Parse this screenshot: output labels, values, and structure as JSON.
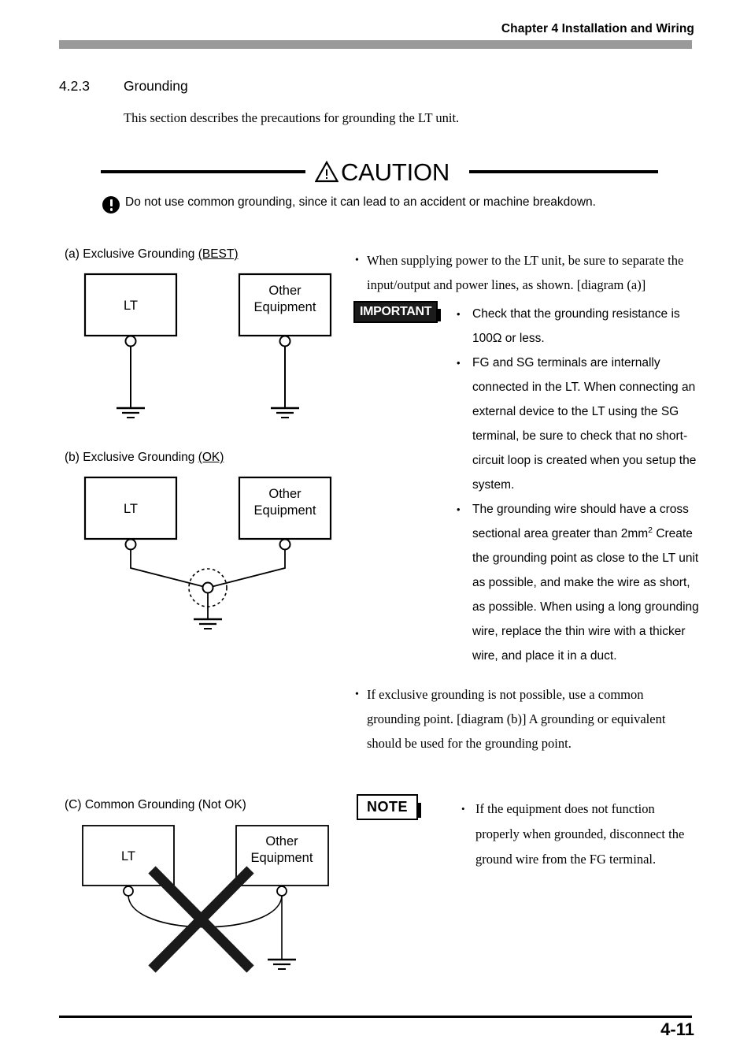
{
  "header": {
    "chapter": "Chapter 4 Installation and Wiring"
  },
  "section": {
    "number": "4.2.3",
    "title": "Grounding",
    "intro": "This section describes the precautions for grounding the LT unit."
  },
  "caution": {
    "label": "CAUTION",
    "icon": "warning-triangle-icon",
    "body_icon": "exclamation-circle-icon",
    "body": "Do not use common grounding, since it can lead to an accident or machine breakdown."
  },
  "diagrams": [
    {
      "id": "a",
      "caption_plain": "(a) Exclusive Grounding ",
      "caption_underlined": "(BEST)",
      "box_left": "LT",
      "box_right_line1": "Other",
      "box_right_line2": "Equipment"
    },
    {
      "id": "b",
      "caption_plain": "(b) Exclusive Grounding ",
      "caption_underlined": "(OK)",
      "box_left": "LT",
      "box_right_line1": "Other",
      "box_right_line2": "Equipment"
    },
    {
      "id": "c",
      "caption_plain": "(C) Common Grounding (Not OK)",
      "caption_underlined": "",
      "box_left": "LT",
      "box_right_line1": "Other",
      "box_right_line2": "Equipment"
    }
  ],
  "right_column": {
    "bullet_power": "When supplying power to the LT unit, be sure to separate the input/output and power lines, as shown. [diagram (a)]",
    "important": {
      "badge": "IMPORTANT",
      "items": [
        "Check that the grounding resistance is 100Ω or less.",
        "FG and SG terminals are internally connected in the LT. When connecting an external device to the LT using the SG terminal, be sure to check that no short-circuit loop is created when you setup the system."
      ],
      "item_wire_part1": "The grounding wire should have a cross sectional area greater than 2mm",
      "item_wire_sup": "2",
      "item_wire_part2": " Create the grounding point as close to the LT unit as possible, and make the wire as short, as possible. When using a long grounding wire, replace the thin wire with a thicker wire, and place it in a duct."
    },
    "bullet_common": "If exclusive grounding is not possible, use a common grounding point. [diagram (b)] A grounding or equivalent should be used for the grounding point.",
    "note": {
      "badge": "NOTE",
      "items": [
        "If the equipment does not function properly when grounded, disconnect the ground wire from the FG terminal."
      ]
    }
  },
  "footer": {
    "page": "4-11"
  },
  "colors": {
    "header_bar": "#9a9a9a",
    "ink": "#000000",
    "paper": "#ffffff"
  }
}
